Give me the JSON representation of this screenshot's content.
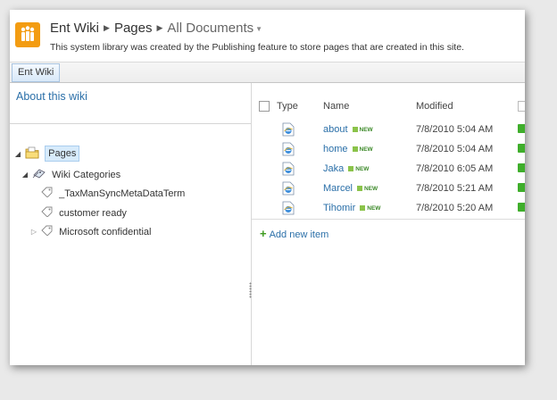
{
  "breadcrumb": {
    "site": "Ent Wiki",
    "library": "Pages",
    "view": "All Documents"
  },
  "description": "This system library was created by the Publishing feature to store pages that are created in this site.",
  "top_nav": {
    "tab": "Ent Wiki"
  },
  "quick_launch": {
    "about": "About this wiki"
  },
  "tree": {
    "pages": "Pages",
    "categories": "Wiki Categories",
    "terms": [
      "_TaxManSyncMetaDataTerm",
      "customer ready",
      "Microsoft confidential"
    ]
  },
  "list": {
    "columns": {
      "type": "Type",
      "name": "Name",
      "modified": "Modified"
    },
    "new_badge": "NEW",
    "rows": [
      {
        "name": "about",
        "modified": "7/8/2010 5:04 AM"
      },
      {
        "name": "home",
        "modified": "7/8/2010 5:04 AM"
      },
      {
        "name": "Jaka",
        "modified": "7/8/2010 6:05 AM"
      },
      {
        "name": "Marcel",
        "modified": "7/8/2010 5:21 AM"
      },
      {
        "name": "Tihomir",
        "modified": "7/8/2010 5:20 AM"
      }
    ],
    "add_new": "Add new item"
  },
  "colors": {
    "link": "#2a6fa8",
    "logo": "#f39c12",
    "new_badge": "#3d8a2a"
  },
  "icons": {
    "site_logo": "sharepoint-site-logo",
    "doc": "ie-document-icon",
    "tag": "tag-icon",
    "folder": "folder-icon"
  }
}
